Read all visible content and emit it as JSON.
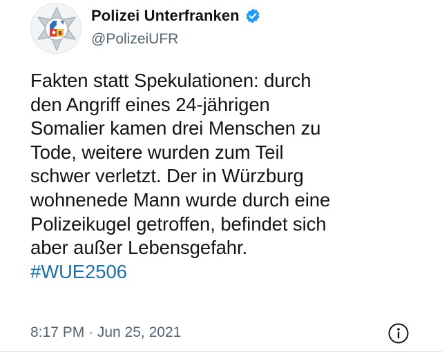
{
  "account": {
    "display_name": "Polizei Unterfranken",
    "handle": "@PolizeiUFR",
    "verified": true,
    "avatar_icon": "bavarian-police-star-logo",
    "verified_color": "#1d9bf0"
  },
  "tweet": {
    "lines": [
      "Fakten statt Spekulationen: durch",
      "den Angriff eines 24-jährigen",
      "Somalier kamen drei Menschen zu",
      "Tode, weitere wurden zum Teil",
      "schwer verletzt. Der in Würzburg",
      "wohnenede Mann wurde durch eine",
      "Polizeikugel getroffen, befindet sich",
      "aber außer Lebensgefahr."
    ],
    "hashtag": "#WUE2506",
    "hashtag_color": "#1d6fa5"
  },
  "footer": {
    "timestamp": "8:17 PM · Jun 25, 2021",
    "info_icon": "info-circle-icon"
  }
}
